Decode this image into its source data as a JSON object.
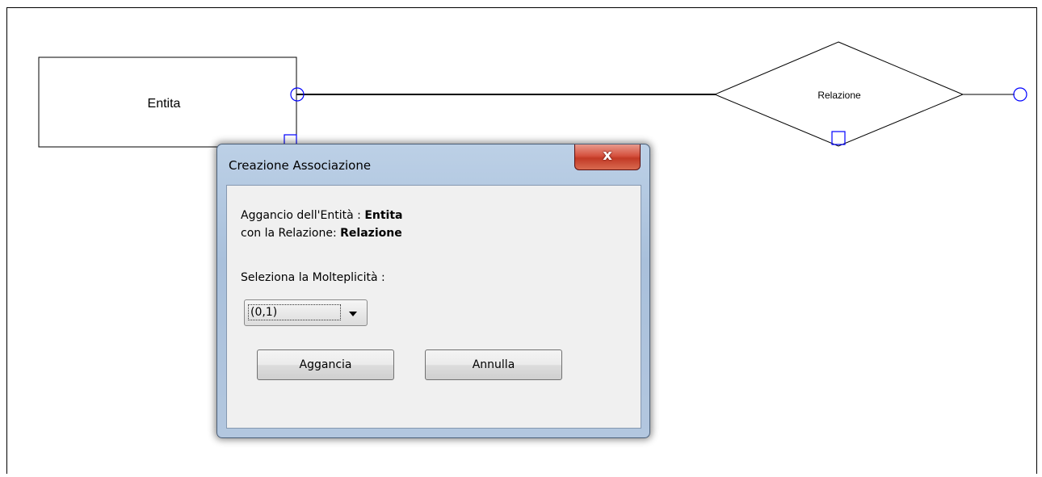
{
  "diagram": {
    "entity_label": "Entita",
    "relation_label": "Relazione",
    "stroke_color": "#000000",
    "connector_color": "#0000ff"
  },
  "dialog": {
    "title": "Creazione Associazione",
    "close_symbol": "x",
    "line1_prefix": "Aggancio dell'Entità : ",
    "line1_value": "Entita",
    "line2_prefix": "con la Relazione: ",
    "line2_value": "Relazione",
    "select_label": "Seleziona la Molteplicità :",
    "select_value": "(0,1)",
    "attach_button": "Aggancia",
    "cancel_button": "Annulla"
  }
}
